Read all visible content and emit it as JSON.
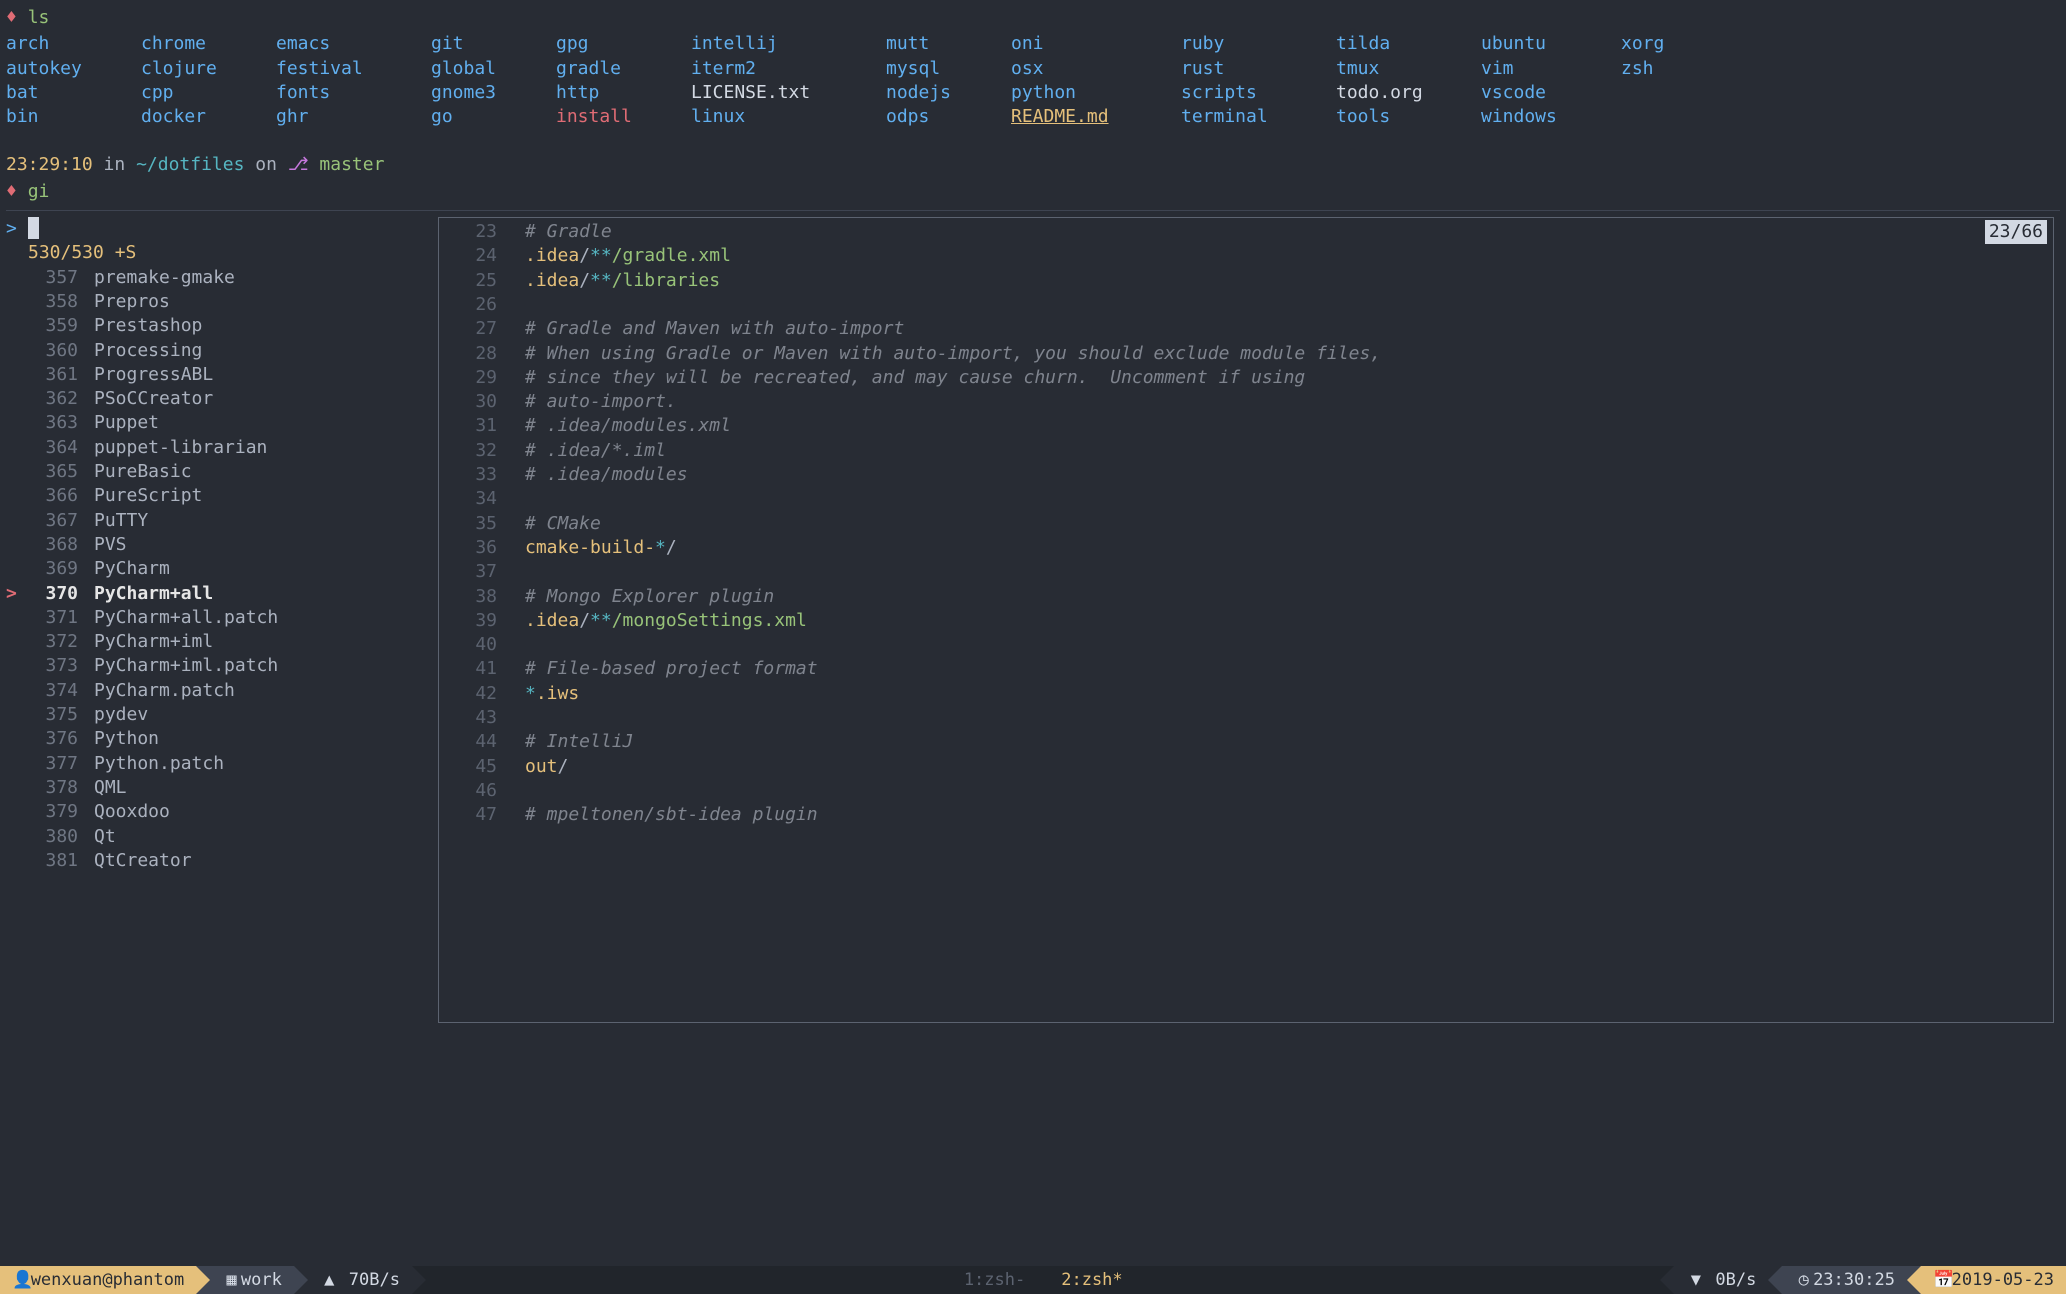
{
  "ls": {
    "cmd": "ls",
    "rows": [
      [
        "arch",
        "chrome",
        "emacs",
        "git",
        "gpg",
        "intellij",
        "mutt",
        "oni",
        "ruby",
        "tilda",
        "ubuntu",
        "xorg"
      ],
      [
        "autokey",
        "clojure",
        "festival",
        "global",
        "gradle",
        "iterm2",
        "mysql",
        "osx",
        "rust",
        "tmux",
        "vim",
        "zsh"
      ],
      [
        "bat",
        "cpp",
        "fonts",
        "gnome3",
        "http",
        "LICENSE.txt",
        "nodejs",
        "python",
        "scripts",
        "todo.org",
        "vscode",
        ""
      ],
      [
        "bin",
        "docker",
        "ghr",
        "go",
        "install",
        "linux",
        "odps",
        "README.md",
        "terminal",
        "tools",
        "windows",
        ""
      ]
    ],
    "types": [
      [
        "d",
        "d",
        "d",
        "d",
        "d",
        "d",
        "d",
        "d",
        "d",
        "d",
        "d",
        "d"
      ],
      [
        "d",
        "d",
        "d",
        "d",
        "d",
        "d",
        "d",
        "d",
        "d",
        "d",
        "d",
        "d"
      ],
      [
        "d",
        "d",
        "d",
        "d",
        "d",
        "p",
        "d",
        "d",
        "d",
        "p",
        "d",
        ""
      ],
      [
        "d",
        "d",
        "d",
        "d",
        "x",
        "d",
        "d",
        "r",
        "d",
        "d",
        "d",
        ""
      ]
    ]
  },
  "prompt": {
    "time": "23:29:10",
    "in": "in",
    "path": "~/dotfiles",
    "on": "on",
    "branch_icon": "⎇",
    "branch": "master",
    "typed": "gi"
  },
  "fzf": {
    "query_prefix": ">",
    "count": "530/530 +S",
    "items": [
      {
        "n": 357,
        "name": "premake-gmake"
      },
      {
        "n": 358,
        "name": "Prepros"
      },
      {
        "n": 359,
        "name": "Prestashop"
      },
      {
        "n": 360,
        "name": "Processing"
      },
      {
        "n": 361,
        "name": "ProgressABL"
      },
      {
        "n": 362,
        "name": "PSoCCreator"
      },
      {
        "n": 363,
        "name": "Puppet"
      },
      {
        "n": 364,
        "name": "puppet-librarian"
      },
      {
        "n": 365,
        "name": "PureBasic"
      },
      {
        "n": 366,
        "name": "PureScript"
      },
      {
        "n": 367,
        "name": "PuTTY"
      },
      {
        "n": 368,
        "name": "PVS"
      },
      {
        "n": 369,
        "name": "PyCharm"
      },
      {
        "n": 370,
        "name": "PyCharm+all",
        "selected": true
      },
      {
        "n": 371,
        "name": "PyCharm+all.patch"
      },
      {
        "n": 372,
        "name": "PyCharm+iml"
      },
      {
        "n": 373,
        "name": "PyCharm+iml.patch"
      },
      {
        "n": 374,
        "name": "PyCharm.patch"
      },
      {
        "n": 375,
        "name": "pydev"
      },
      {
        "n": 376,
        "name": "Python"
      },
      {
        "n": 377,
        "name": "Python.patch"
      },
      {
        "n": 378,
        "name": "QML"
      },
      {
        "n": 379,
        "name": "Qooxdoo"
      },
      {
        "n": 380,
        "name": "Qt"
      },
      {
        "n": 381,
        "name": "QtCreator"
      }
    ]
  },
  "preview": {
    "position": "23/66",
    "lines": [
      {
        "ln": 23,
        "t": "comment",
        "s": "# Gradle"
      },
      {
        "ln": 24,
        "t": "idea",
        "path": ".idea",
        "glob": "/**",
        "file": "/gradle.xml"
      },
      {
        "ln": 25,
        "t": "idea",
        "path": ".idea",
        "glob": "/**",
        "file": "/libraries"
      },
      {
        "ln": 26,
        "t": "blank"
      },
      {
        "ln": 27,
        "t": "comment",
        "s": "# Gradle and Maven with auto-import"
      },
      {
        "ln": 28,
        "t": "comment",
        "s": "# When using Gradle or Maven with auto-import, you should exclude module files,"
      },
      {
        "ln": 29,
        "t": "comment",
        "s": "# since they will be recreated, and may cause churn.  Uncomment if using"
      },
      {
        "ln": 30,
        "t": "comment",
        "s": "# auto-import."
      },
      {
        "ln": 31,
        "t": "comment",
        "s": "# .idea/modules.xml"
      },
      {
        "ln": 32,
        "t": "comment",
        "s": "# .idea/*.iml"
      },
      {
        "ln": 33,
        "t": "comment",
        "s": "# .idea/modules"
      },
      {
        "ln": 34,
        "t": "blank"
      },
      {
        "ln": 35,
        "t": "comment",
        "s": "# CMake"
      },
      {
        "ln": 36,
        "t": "cmake",
        "a": "cmake-build-",
        "b": "*",
        "c": "/"
      },
      {
        "ln": 37,
        "t": "blank"
      },
      {
        "ln": 38,
        "t": "comment",
        "s": "# Mongo Explorer plugin"
      },
      {
        "ln": 39,
        "t": "idea",
        "path": ".idea",
        "glob": "/**",
        "file": "/mongoSettings.xml"
      },
      {
        "ln": 40,
        "t": "blank"
      },
      {
        "ln": 41,
        "t": "comment",
        "s": "# File-based project format"
      },
      {
        "ln": 42,
        "t": "iws",
        "a": "*",
        "b": ".iws"
      },
      {
        "ln": 43,
        "t": "blank"
      },
      {
        "ln": 44,
        "t": "comment",
        "s": "# IntelliJ"
      },
      {
        "ln": 45,
        "t": "out",
        "a": "out",
        "b": "/"
      },
      {
        "ln": 46,
        "t": "blank"
      },
      {
        "ln": 47,
        "t": "comment",
        "s": "# mpeltonen/sbt-idea plugin"
      }
    ]
  },
  "status": {
    "user": "wenxuan@phantom",
    "session": "work",
    "up": "70B/s",
    "windows": [
      {
        "label": "1:zsh-",
        "active": false
      },
      {
        "label": "2:zsh*",
        "active": true
      }
    ],
    "down": "0B/s",
    "clock": "23:30:25",
    "date": "2019-05-23",
    "icons": {
      "user": "👤",
      "grid": "▦",
      "up": "▲",
      "down": "▼",
      "clock": "◷",
      "cal": "📅"
    }
  }
}
